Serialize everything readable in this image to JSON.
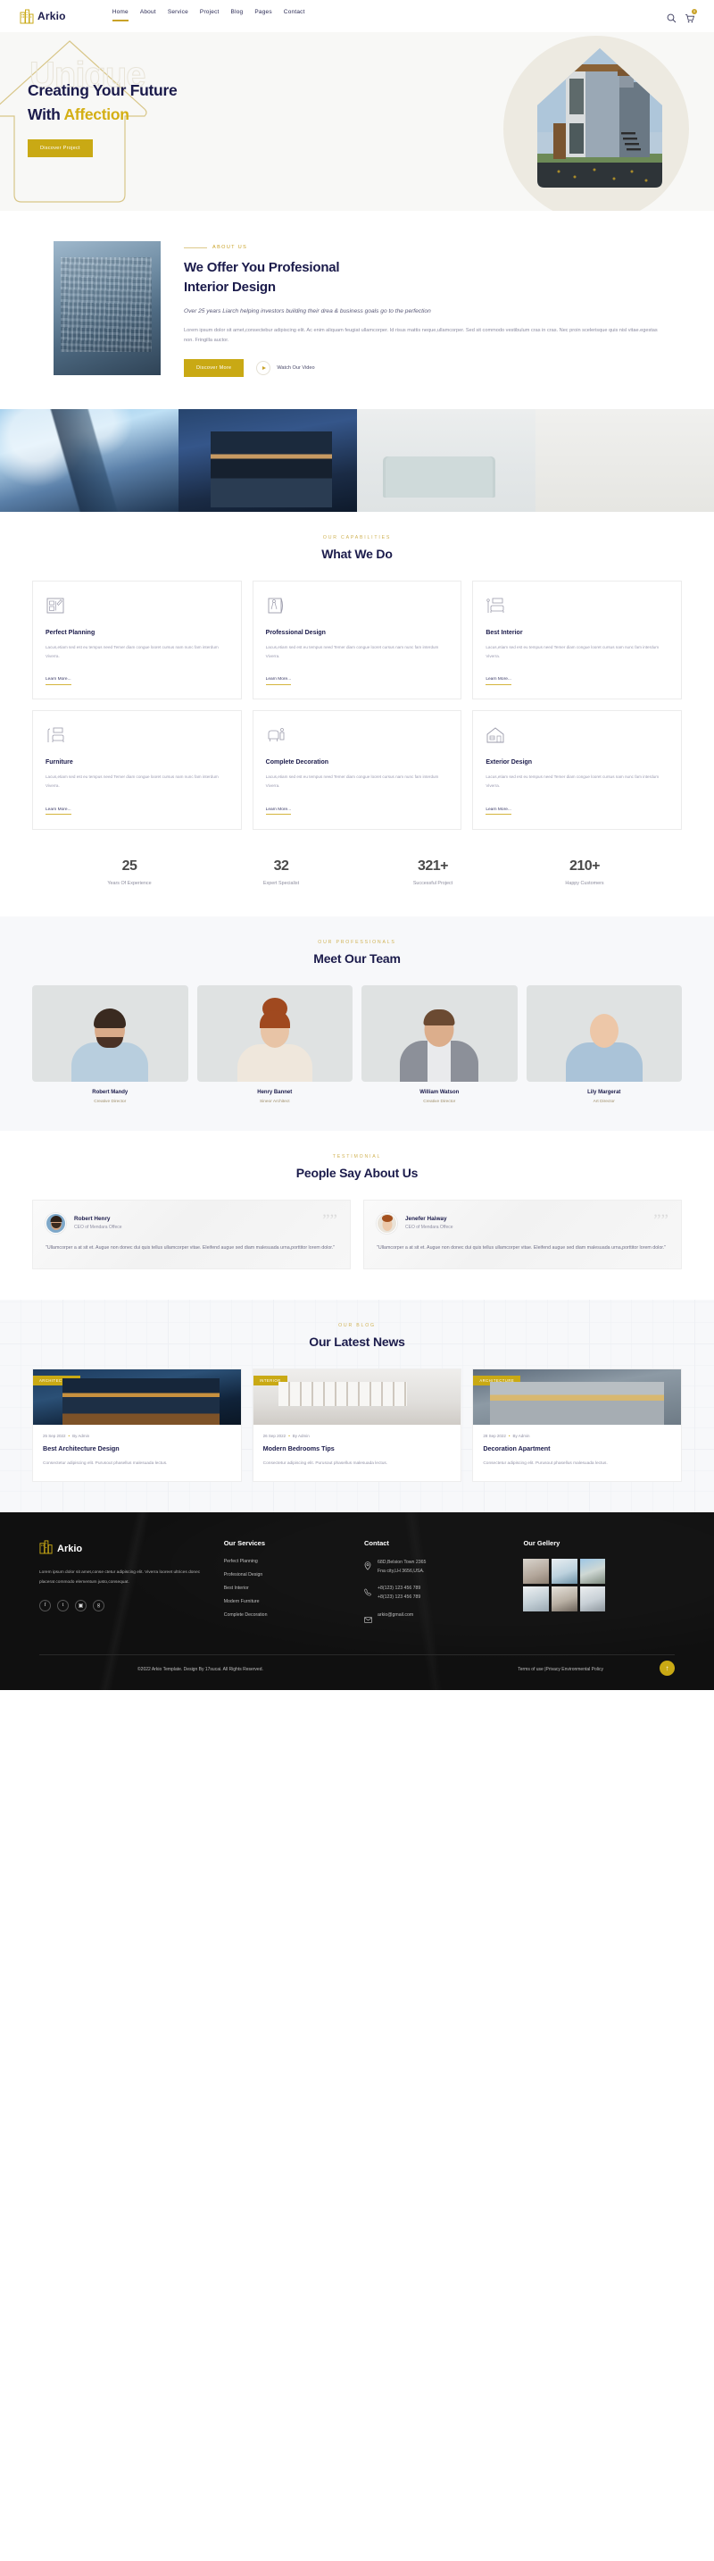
{
  "brand": {
    "name": "Arkio",
    "icon": "building-logo-icon"
  },
  "nav": {
    "links": [
      {
        "label": "Home",
        "active": true
      },
      {
        "label": "About",
        "active": false
      },
      {
        "label": "Service",
        "active": false
      },
      {
        "label": "Project",
        "active": false
      },
      {
        "label": "Blog",
        "active": false
      },
      {
        "label": "Pages",
        "active": false
      },
      {
        "label": "Contact",
        "active": false
      }
    ],
    "search_icon": "search-icon",
    "cart_icon": "cart-icon",
    "cart_count": "0"
  },
  "hero": {
    "ghost_text": "Unique",
    "title_line1": "Creating Your Future",
    "title_line2_plain": "With ",
    "title_line2_accent": "Affection",
    "cta": "Discover Project"
  },
  "about": {
    "eyebrow": "About Us",
    "title_line1": "We Offer You Profesional",
    "title_line2": "Interior Design",
    "lead": "Over 25 years Liarch helping investors building their drea & business goals go to the perfection",
    "copy": "Lorem ipsum dolor sit amet,consectebur adipiscing elit. Ac enim aliquam feugiat ullamcorper. Id risus mattis neque,ullamcorper. Sed sit commodo vestibulum cras in cras. Nec proin scelerisque quis nisl vitae.egestas non. Fringilla auctor.",
    "cta": "Discover More",
    "video_label": "Watch Our Video"
  },
  "services": {
    "eyebrow": "Our Capabilities",
    "title": "What We Do",
    "learn_more": "Learn More...",
    "description": "Lacus,etiam sed est eu tempus need Temer diam congue looret cursus nam nunc fam interdum Viverra.",
    "items": [
      {
        "name": "Perfect Planning",
        "icon": "blueprint-icon"
      },
      {
        "name": "Professional Design",
        "icon": "compass-icon"
      },
      {
        "name": "Best Interior",
        "icon": "bed-icon"
      },
      {
        "name": "Furniture",
        "icon": "lamp-sofa-icon"
      },
      {
        "name": "Complete Decoration",
        "icon": "armchair-icon"
      },
      {
        "name": "Exterior Design",
        "icon": "house-icon"
      }
    ]
  },
  "stats": [
    {
      "value": "25",
      "label": "Years Of Experience"
    },
    {
      "value": "32",
      "label": "Expert Specialist"
    },
    {
      "value": "321+",
      "label": "Successful Project"
    },
    {
      "value": "210+",
      "label": "Happy Customers"
    }
  ],
  "team": {
    "eyebrow": "Our Professionals",
    "title": "Meet Our Team",
    "members": [
      {
        "name": "Robert Mandy",
        "role": "Creative Director",
        "skin": "#d9ab8a",
        "hair": "#3a2a20",
        "shirt": "#b8cede"
      },
      {
        "name": "Henry Bannet",
        "role": "Sineor Architect",
        "skin": "#e8c4a6",
        "hair": "#a0491f",
        "shirt": "#efe7dc"
      },
      {
        "name": "William Watson",
        "role": "Creative Director",
        "skin": "#dcae8c",
        "hair": "#6b4a32",
        "shirt": "#8c9099"
      },
      {
        "name": "Lily Margerat",
        "role": "Art Director",
        "skin": "#edc7a8",
        "hair": "#c89a55",
        "shirt": "#aac3d8"
      }
    ]
  },
  "testimonials": {
    "eyebrow": "Testimonial",
    "title": "People Say About Us",
    "items": [
      {
        "name": "Robert Henry",
        "role": "CEO of Mendara Offece",
        "text": "\"Ullamcorper a at sit et. Augue non donec dui quis tellus ullamcorper vitae. Eleifend augue sed diam malesuada urna,porttitor lorem dolor.\"",
        "skin": "#d5a481",
        "hair": "#2e2119",
        "shirt": "#7fa8c9"
      },
      {
        "name": "Jenefer Haiway",
        "role": "CEO of Mendara Offece",
        "text": "\"Ullamcorper a at sit et. Augue non donec dui quis tellus ullamcorper vitae. Eleifend augue sed diam malesuada urna,porttitor lorem dolor.\"",
        "skin": "#ecc9ab",
        "hair": "#a4511f",
        "shirt": "#e9e3d9"
      }
    ],
    "quote_icon": "quote-icon"
  },
  "blog": {
    "eyebrow": "Our Blog",
    "title": "Our Latest News",
    "posts": [
      {
        "category": "ARCHITECTURE",
        "date": "25 Sep 2022",
        "author": "By Admin",
        "title": "Best Architecture Design",
        "excerpt": "Consectetur adipiscing elit. Purusout phasellus malesuada lectus."
      },
      {
        "category": "INTERIOR",
        "date": "26 Sep 2022",
        "author": "By Admin",
        "title": "Modern Bedrooms Tips",
        "excerpt": "Consectetur adipiscing elit. Purusout phasellus malesuada lectus."
      },
      {
        "category": "ARCHITECTURE",
        "date": "28 Sep 2022",
        "author": "By Admin",
        "title": "Decoration Apartment",
        "excerpt": "Consectetur adipiscing elit. Purusout phasellus malesuada lectus."
      }
    ]
  },
  "footer": {
    "brand": "Arkio",
    "about": "Lorem ipsum dolor sit amet,conse ctetur adipiscing elit. Viverra looreet ultrices donec placerat commodo elementum justo,consequat.",
    "socials": [
      {
        "name": "facebook-icon",
        "glyph": "f"
      },
      {
        "name": "twitter-icon",
        "glyph": "t"
      },
      {
        "name": "instagram-icon",
        "glyph": "▣"
      },
      {
        "name": "google-plus-icon",
        "glyph": "g"
      }
    ],
    "services_title": "Our Services",
    "services": [
      "Perfect Planning",
      "Profesional Design",
      "Best Interior",
      "Modern Furniture",
      "Complete Decoration"
    ],
    "contact_title": "Contact",
    "contact": {
      "address_line1": "68D,Belsion Town 2365",
      "address_line2": "Fna city,LH 3656,USA.",
      "phone1": "+8(123) 123 456 789",
      "phone2": "+8(123) 123 456 789",
      "email": "arkio@gmail.com",
      "location_icon": "location-pin-icon",
      "phone_icon": "phone-icon",
      "email_icon": "envelope-icon"
    },
    "gallery_title": "Our Gellery",
    "copyright": "©2022 Arkio Template. Design By 17sucai. All Rights Reserved.",
    "legal": "Terms of use |Privacy Environmental Policy",
    "to_top_icon": "arrow-up-icon"
  }
}
